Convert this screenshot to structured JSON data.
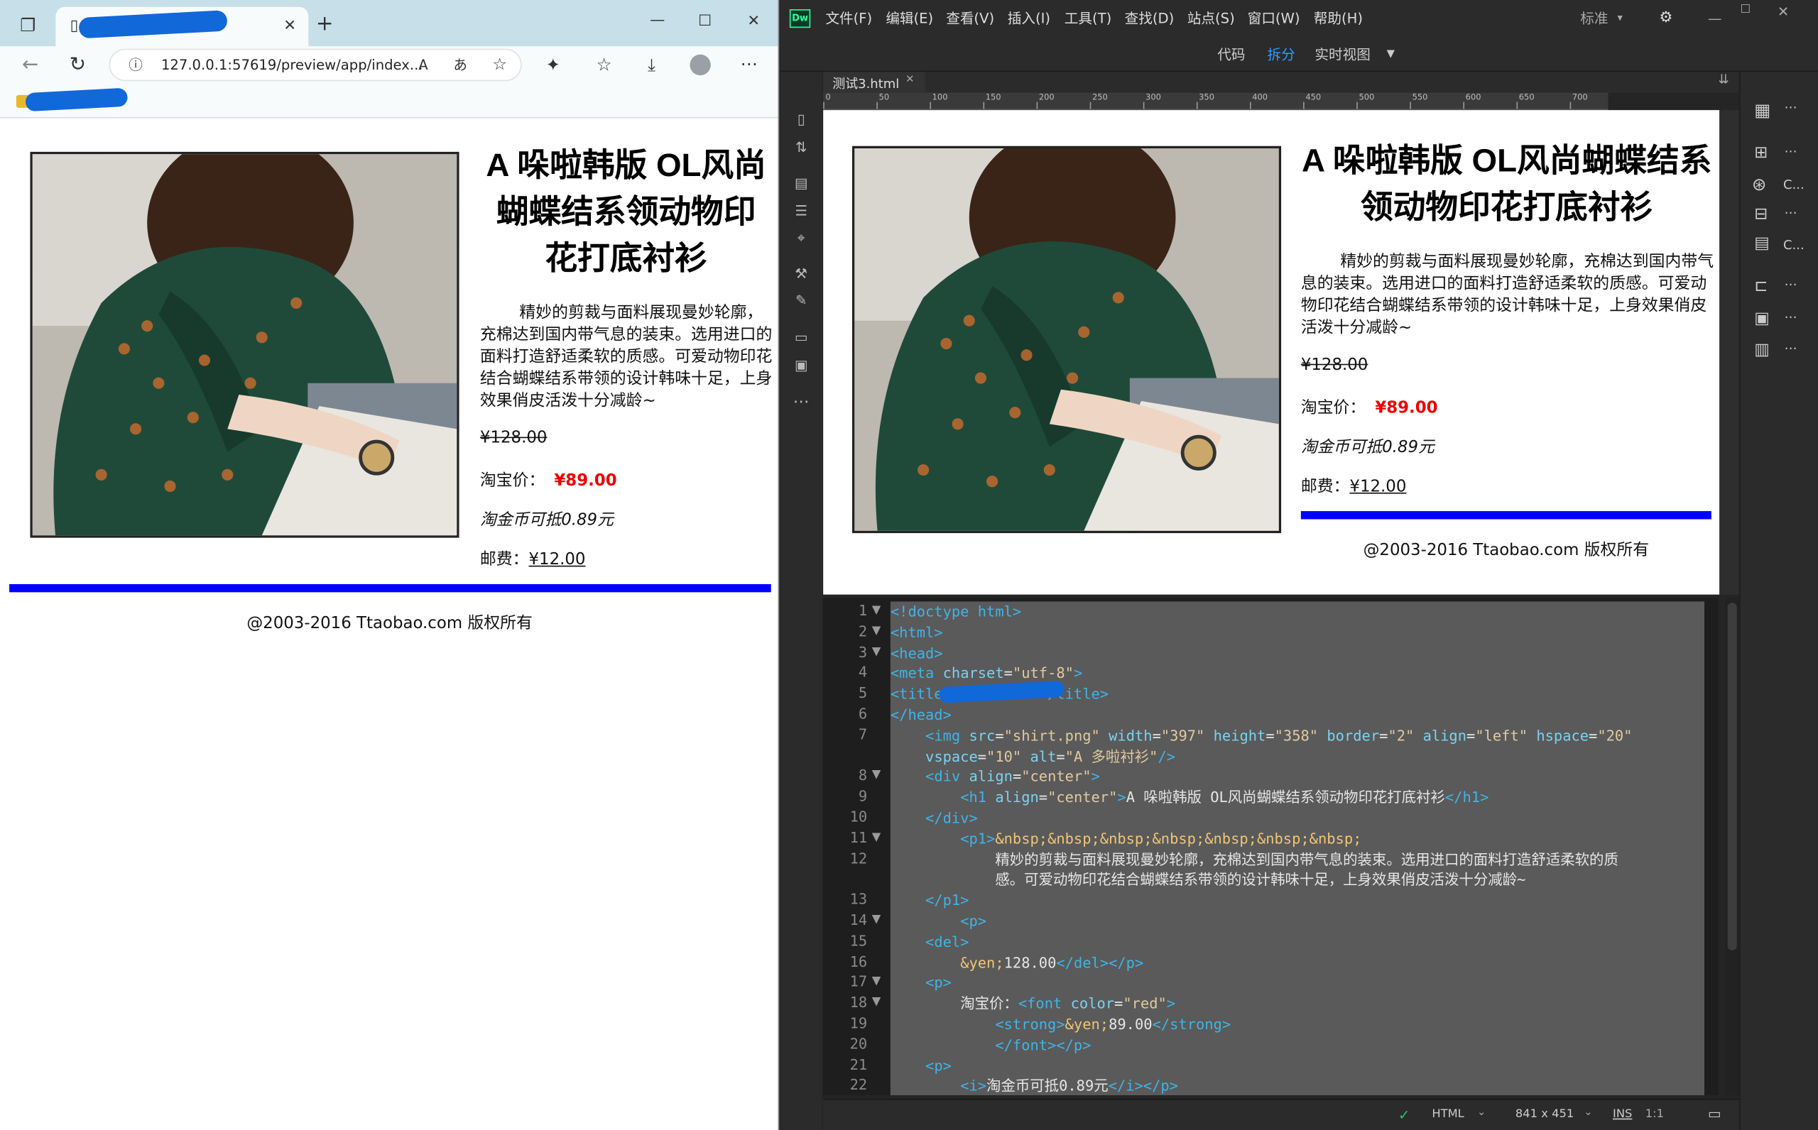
{
  "browser": {
    "url": "127.0.0.1:57619/preview/app/index...",
    "window_controls": [
      "—",
      "☐",
      "✕"
    ],
    "new_tab": "+",
    "tab_close": "✕",
    "toolbar_icons": [
      "back-icon",
      "refresh-icon",
      "info-icon",
      "read-aloud-icon",
      "translate-icon",
      "add-favorite-icon",
      "extensions-icon",
      "favorites-icon",
      "downloads-icon",
      "profile-icon",
      "more-icon"
    ]
  },
  "product": {
    "title": "A 哚啦韩版 OL风尚蝴蝶结系领动物印花打底衬衫",
    "description": "精妙的剪裁与面料展现曼妙轮廓，充棉达到国内带气息的装束。选用进口的面料打造舒适柔软的质感。可爱动物印花结合蝴蝶结系带领的设计韩味十足，上身效果俏皮活泼十分减龄~",
    "old_price": "¥128.00",
    "price_label": "淘宝价：",
    "price": "¥89.00",
    "coin_note": "淘金币可抵0.89元",
    "shipping_label": "邮费：",
    "shipping": "¥12.00",
    "footer": "@2003-2016 Ttaobao.com 版权所有",
    "image_alt": "A 多啦衬衫"
  },
  "dw": {
    "logo": "Dw",
    "menu": [
      "文件(F)",
      "编辑(E)",
      "查看(V)",
      "插入(I)",
      "工具(T)",
      "查找(D)",
      "站点(S)",
      "窗口(W)",
      "帮助(H)"
    ],
    "workspace": "标准",
    "views": [
      "代码",
      "拆分",
      "实时视图"
    ],
    "active_view": "拆分",
    "doc_tab": "测试3.html",
    "doc_tab_close": "✕",
    "ruler": [
      "0",
      "50",
      "100",
      "150",
      "200",
      "250",
      "300",
      "350",
      "400",
      "450",
      "500",
      "550",
      "600",
      "650",
      "700"
    ],
    "status": {
      "language": "HTML",
      "size": "841 x 451",
      "mode": "INS",
      "pos": "1:1"
    },
    "right_panel_labels": [
      "C...",
      "C..."
    ],
    "code_lines": [
      {
        "n": "1",
        "fold": "▼",
        "html": "<span class=\"tag\">&lt;!doctype html&gt;</span>"
      },
      {
        "n": "2",
        "fold": "▼",
        "html": "<span class=\"tag\">&lt;html&gt;</span>"
      },
      {
        "n": "3",
        "fold": "▼",
        "html": "<span class=\"tag\">&lt;head&gt;</span>"
      },
      {
        "n": "4",
        "fold": "",
        "html": "<span class=\"tag\">&lt;meta</span> <span class=\"attr\">charset</span>=<span class=\"val\">\"utf-8\"</span><span class=\"tag\">&gt;</span>"
      },
      {
        "n": "5",
        "fold": "",
        "html": "<span class=\"tag\">&lt;title&gt;</span>          <span class=\"tag\">&lt;/title&gt;</span>"
      },
      {
        "n": "6",
        "fold": "",
        "html": "<span class=\"tag\">&lt;/head&gt;</span>"
      },
      {
        "n": "7",
        "fold": "",
        "html": "    <span class=\"tag\">&lt;img</span> <span class=\"attr\">src</span>=<span class=\"val\">\"shirt.png\"</span> <span class=\"attr\">width</span>=<span class=\"val\">\"397\"</span> <span class=\"attr\">height</span>=<span class=\"val\">\"358\"</span> <span class=\"attr\">border</span>=<span class=\"val\">\"2\"</span> <span class=\"attr\">align</span>=<span class=\"val\">\"left\"</span> <span class=\"attr\">hspace</span>=<span class=\"val\">\"20\"</span>"
      },
      {
        "n": "",
        "fold": "",
        "html": "    <span class=\"attr\">vspace</span>=<span class=\"val\">\"10\"</span> <span class=\"attr\">alt</span>=<span class=\"val\">\"A 多啦衬衫\"</span><span class=\"tag\">/&gt;</span>"
      },
      {
        "n": "8",
        "fold": "▼",
        "html": "    <span class=\"tag\">&lt;div</span> <span class=\"attr\">align</span>=<span class=\"val\">\"center\"</span><span class=\"tag\">&gt;</span>"
      },
      {
        "n": "9",
        "fold": "",
        "html": "        <span class=\"tag\">&lt;h1</span> <span class=\"attr\">align</span>=<span class=\"val\">\"center\"</span><span class=\"tag\">&gt;</span><span class=\"txt\">A 哚啦韩版 OL风尚蝴蝶结系领动物印花打底衬衫</span><span class=\"tag\">&lt;/h1&gt;</span>"
      },
      {
        "n": "10",
        "fold": "",
        "html": "    <span class=\"tag\">&lt;/div&gt;</span>"
      },
      {
        "n": "11",
        "fold": "▼",
        "html": "        <span class=\"tag\">&lt;p1&gt;</span><span class=\"ent\">&amp;nbsp;&amp;nbsp;&amp;nbsp;&amp;nbsp;&amp;nbsp;&amp;nbsp;&amp;nbsp;</span>"
      },
      {
        "n": "12",
        "fold": "",
        "html": "            <span class=\"txt\">精妙的剪裁与面料展现曼妙轮廓，充棉达到国内带气息的装束。选用进口的面料打造舒适柔软的质</span>"
      },
      {
        "n": "",
        "fold": "",
        "html": "            <span class=\"txt\">感。可爱动物印花结合蝴蝶结系带领的设计韩味十足，上身效果俏皮活泼十分减龄~</span>"
      },
      {
        "n": "13",
        "fold": "",
        "html": "    <span class=\"tag\">&lt;/p1&gt;</span>"
      },
      {
        "n": "14",
        "fold": "▼",
        "html": "        <span class=\"tag\">&lt;p&gt;</span>"
      },
      {
        "n": "15",
        "fold": "",
        "html": "    <span class=\"tag\">&lt;del&gt;</span>"
      },
      {
        "n": "16",
        "fold": "",
        "html": "        <span class=\"ent\">&amp;yen;</span><span class=\"txt\">128.00</span><span class=\"tag\">&lt;/del&gt;&lt;/p&gt;</span>"
      },
      {
        "n": "17",
        "fold": "▼",
        "html": "    <span class=\"tag\">&lt;p&gt;</span>"
      },
      {
        "n": "18",
        "fold": "▼",
        "html": "        <span class=\"txt\">淘宝价：</span><span class=\"tag\">&lt;font</span> <span class=\"attr\">color</span>=<span class=\"val\">\"red\"</span><span class=\"tag\">&gt;</span>"
      },
      {
        "n": "19",
        "fold": "",
        "html": "            <span class=\"tag\">&lt;strong&gt;</span><span class=\"ent\">&amp;yen;</span><span class=\"txt\">89.00</span><span class=\"tag\">&lt;/strong&gt;</span>"
      },
      {
        "n": "20",
        "fold": "",
        "html": "            <span class=\"tag\">&lt;/font&gt;&lt;/p&gt;</span>"
      },
      {
        "n": "21",
        "fold": "",
        "html": "    <span class=\"tag\">&lt;p&gt;</span>"
      },
      {
        "n": "22",
        "fold": "",
        "html": "        <span class=\"tag\">&lt;i&gt;</span><span class=\"txt\">淘金币可抵0.89元</span><span class=\"tag\">&lt;/i&gt;&lt;/p&gt;</span>"
      }
    ]
  }
}
